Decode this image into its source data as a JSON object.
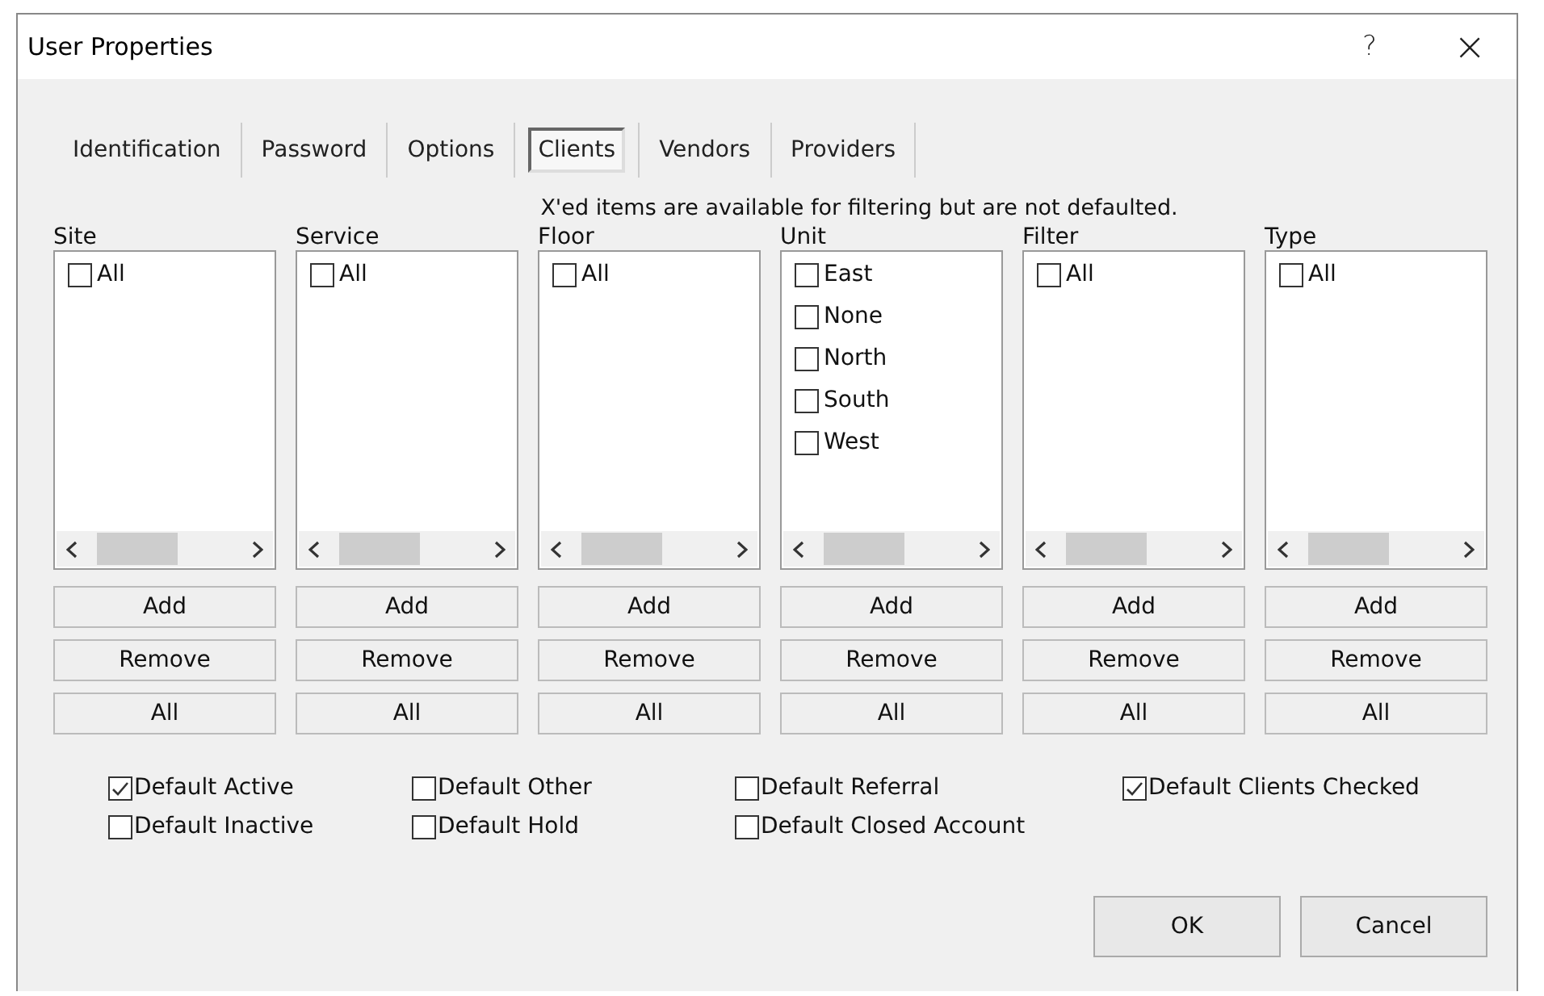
{
  "window": {
    "title": "User Properties",
    "help": "?",
    "close": "×"
  },
  "tabs": [
    {
      "label": "Identification",
      "selected": false
    },
    {
      "label": "Password",
      "selected": false
    },
    {
      "label": "Options",
      "selected": false
    },
    {
      "label": "Clients",
      "selected": true
    },
    {
      "label": "Vendors",
      "selected": false
    },
    {
      "label": "Providers",
      "selected": false
    }
  ],
  "note": "X'ed items are available for filtering but are not defaulted.",
  "lists": [
    {
      "label": "Site",
      "items": [
        {
          "label": "All",
          "checked": false
        }
      ],
      "buttons": [
        "Add",
        "Remove",
        "All"
      ]
    },
    {
      "label": "Service",
      "items": [
        {
          "label": "All",
          "checked": false
        }
      ],
      "buttons": [
        "Add",
        "Remove",
        "All"
      ]
    },
    {
      "label": "Floor",
      "items": [
        {
          "label": "All",
          "checked": false
        }
      ],
      "buttons": [
        "Add",
        "Remove",
        "All"
      ]
    },
    {
      "label": "Unit",
      "items": [
        {
          "label": "East",
          "checked": false
        },
        {
          "label": "None",
          "checked": false
        },
        {
          "label": "North",
          "checked": false
        },
        {
          "label": "South",
          "checked": false
        },
        {
          "label": "West",
          "checked": false
        }
      ],
      "buttons": [
        "Add",
        "Remove",
        "All"
      ]
    },
    {
      "label": "Filter",
      "items": [
        {
          "label": "All",
          "checked": false
        }
      ],
      "buttons": [
        "Add",
        "Remove",
        "All"
      ]
    },
    {
      "label": "Type",
      "items": [
        {
          "label": "All",
          "checked": false
        }
      ],
      "buttons": [
        "Add",
        "Remove",
        "All"
      ]
    }
  ],
  "defaults": [
    [
      {
        "label": "Default Active",
        "checked": true
      },
      {
        "label": "Default Inactive",
        "checked": false
      }
    ],
    [
      {
        "label": "Default Other",
        "checked": false
      },
      {
        "label": "Default Hold",
        "checked": false
      }
    ],
    [
      {
        "label": "Default Referral",
        "checked": false
      },
      {
        "label": "Default Closed Account",
        "checked": false
      }
    ],
    [
      {
        "label": "Default Clients Checked",
        "checked": true
      }
    ]
  ],
  "buttons": [
    "OK",
    "Cancel"
  ]
}
